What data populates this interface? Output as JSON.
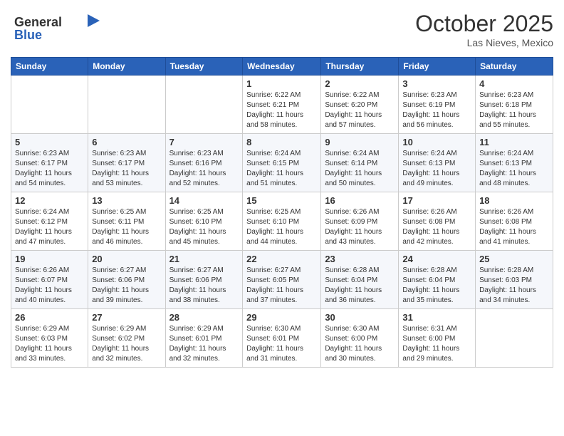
{
  "header": {
    "logo_line1": "General",
    "logo_line2": "Blue",
    "month": "October 2025",
    "location": "Las Nieves, Mexico"
  },
  "days_of_week": [
    "Sunday",
    "Monday",
    "Tuesday",
    "Wednesday",
    "Thursday",
    "Friday",
    "Saturday"
  ],
  "weeks": [
    [
      {
        "day": "",
        "info": ""
      },
      {
        "day": "",
        "info": ""
      },
      {
        "day": "",
        "info": ""
      },
      {
        "day": "1",
        "info": "Sunrise: 6:22 AM\nSunset: 6:21 PM\nDaylight: 11 hours\nand 58 minutes."
      },
      {
        "day": "2",
        "info": "Sunrise: 6:22 AM\nSunset: 6:20 PM\nDaylight: 11 hours\nand 57 minutes."
      },
      {
        "day": "3",
        "info": "Sunrise: 6:23 AM\nSunset: 6:19 PM\nDaylight: 11 hours\nand 56 minutes."
      },
      {
        "day": "4",
        "info": "Sunrise: 6:23 AM\nSunset: 6:18 PM\nDaylight: 11 hours\nand 55 minutes."
      }
    ],
    [
      {
        "day": "5",
        "info": "Sunrise: 6:23 AM\nSunset: 6:17 PM\nDaylight: 11 hours\nand 54 minutes."
      },
      {
        "day": "6",
        "info": "Sunrise: 6:23 AM\nSunset: 6:17 PM\nDaylight: 11 hours\nand 53 minutes."
      },
      {
        "day": "7",
        "info": "Sunrise: 6:23 AM\nSunset: 6:16 PM\nDaylight: 11 hours\nand 52 minutes."
      },
      {
        "day": "8",
        "info": "Sunrise: 6:24 AM\nSunset: 6:15 PM\nDaylight: 11 hours\nand 51 minutes."
      },
      {
        "day": "9",
        "info": "Sunrise: 6:24 AM\nSunset: 6:14 PM\nDaylight: 11 hours\nand 50 minutes."
      },
      {
        "day": "10",
        "info": "Sunrise: 6:24 AM\nSunset: 6:13 PM\nDaylight: 11 hours\nand 49 minutes."
      },
      {
        "day": "11",
        "info": "Sunrise: 6:24 AM\nSunset: 6:13 PM\nDaylight: 11 hours\nand 48 minutes."
      }
    ],
    [
      {
        "day": "12",
        "info": "Sunrise: 6:24 AM\nSunset: 6:12 PM\nDaylight: 11 hours\nand 47 minutes."
      },
      {
        "day": "13",
        "info": "Sunrise: 6:25 AM\nSunset: 6:11 PM\nDaylight: 11 hours\nand 46 minutes."
      },
      {
        "day": "14",
        "info": "Sunrise: 6:25 AM\nSunset: 6:10 PM\nDaylight: 11 hours\nand 45 minutes."
      },
      {
        "day": "15",
        "info": "Sunrise: 6:25 AM\nSunset: 6:10 PM\nDaylight: 11 hours\nand 44 minutes."
      },
      {
        "day": "16",
        "info": "Sunrise: 6:26 AM\nSunset: 6:09 PM\nDaylight: 11 hours\nand 43 minutes."
      },
      {
        "day": "17",
        "info": "Sunrise: 6:26 AM\nSunset: 6:08 PM\nDaylight: 11 hours\nand 42 minutes."
      },
      {
        "day": "18",
        "info": "Sunrise: 6:26 AM\nSunset: 6:08 PM\nDaylight: 11 hours\nand 41 minutes."
      }
    ],
    [
      {
        "day": "19",
        "info": "Sunrise: 6:26 AM\nSunset: 6:07 PM\nDaylight: 11 hours\nand 40 minutes."
      },
      {
        "day": "20",
        "info": "Sunrise: 6:27 AM\nSunset: 6:06 PM\nDaylight: 11 hours\nand 39 minutes."
      },
      {
        "day": "21",
        "info": "Sunrise: 6:27 AM\nSunset: 6:06 PM\nDaylight: 11 hours\nand 38 minutes."
      },
      {
        "day": "22",
        "info": "Sunrise: 6:27 AM\nSunset: 6:05 PM\nDaylight: 11 hours\nand 37 minutes."
      },
      {
        "day": "23",
        "info": "Sunrise: 6:28 AM\nSunset: 6:04 PM\nDaylight: 11 hours\nand 36 minutes."
      },
      {
        "day": "24",
        "info": "Sunrise: 6:28 AM\nSunset: 6:04 PM\nDaylight: 11 hours\nand 35 minutes."
      },
      {
        "day": "25",
        "info": "Sunrise: 6:28 AM\nSunset: 6:03 PM\nDaylight: 11 hours\nand 34 minutes."
      }
    ],
    [
      {
        "day": "26",
        "info": "Sunrise: 6:29 AM\nSunset: 6:03 PM\nDaylight: 11 hours\nand 33 minutes."
      },
      {
        "day": "27",
        "info": "Sunrise: 6:29 AM\nSunset: 6:02 PM\nDaylight: 11 hours\nand 32 minutes."
      },
      {
        "day": "28",
        "info": "Sunrise: 6:29 AM\nSunset: 6:01 PM\nDaylight: 11 hours\nand 32 minutes."
      },
      {
        "day": "29",
        "info": "Sunrise: 6:30 AM\nSunset: 6:01 PM\nDaylight: 11 hours\nand 31 minutes."
      },
      {
        "day": "30",
        "info": "Sunrise: 6:30 AM\nSunset: 6:00 PM\nDaylight: 11 hours\nand 30 minutes."
      },
      {
        "day": "31",
        "info": "Sunrise: 6:31 AM\nSunset: 6:00 PM\nDaylight: 11 hours\nand 29 minutes."
      },
      {
        "day": "",
        "info": ""
      }
    ]
  ]
}
